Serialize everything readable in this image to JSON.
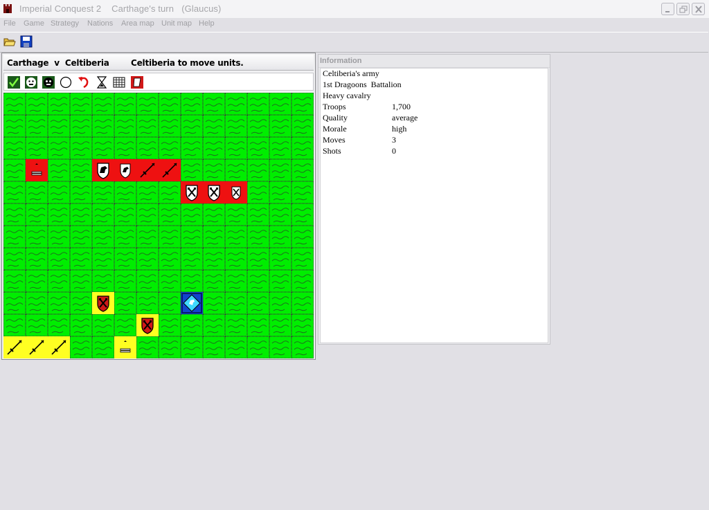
{
  "window": {
    "title": "Imperial Conquest 2    Carthage's turn   (Glaucus)"
  },
  "menu": [
    "File",
    "Game",
    "Strategy",
    "Nations",
    "Area map",
    "Unit map",
    "Help"
  ],
  "toolbar": {
    "buttons": [
      "open-folder-icon",
      "save-disk-icon"
    ]
  },
  "battle": {
    "title": "Carthage  v  Celtiberia",
    "status": "Celtiberia to move units.",
    "tools": [
      "accept-check-icon",
      "face-icon",
      "face-dark-icon",
      "circle-icon",
      "undo-arrow-icon",
      "hourglass-icon",
      "wall-grid-icon",
      "flag-icon"
    ],
    "grid": {
      "cols": 14,
      "rows": 12
    },
    "units": [
      {
        "side": "Carthage",
        "type": "artillery",
        "row": 3,
        "col": 1
      },
      {
        "side": "Carthage",
        "type": "cavalry",
        "row": 3,
        "col": 4
      },
      {
        "side": "Carthage",
        "type": "light-cavalry",
        "row": 3,
        "col": 5
      },
      {
        "side": "Carthage",
        "type": "spearmen",
        "row": 3,
        "col": 6
      },
      {
        "side": "Carthage",
        "type": "spearmen",
        "row": 3,
        "col": 7
      },
      {
        "side": "Carthage",
        "type": "infantry",
        "row": 4,
        "col": 8
      },
      {
        "side": "Carthage",
        "type": "infantry",
        "row": 4,
        "col": 9
      },
      {
        "side": "Carthage",
        "type": "light-infantry",
        "row": 4,
        "col": 10
      },
      {
        "side": "Celtiberia",
        "type": "infantry",
        "row": 9,
        "col": 4
      },
      {
        "side": "Celtiberia",
        "type": "heavy-cavalry-selected",
        "row": 9,
        "col": 8
      },
      {
        "side": "Celtiberia",
        "type": "infantry",
        "row": 10,
        "col": 6
      },
      {
        "side": "Celtiberia",
        "type": "spearmen",
        "row": 11,
        "col": 0
      },
      {
        "side": "Celtiberia",
        "type": "spearmen",
        "row": 11,
        "col": 1
      },
      {
        "side": "Celtiberia",
        "type": "spearmen",
        "row": 11,
        "col": 2
      },
      {
        "side": "Celtiberia",
        "type": "artillery",
        "row": 11,
        "col": 5
      }
    ],
    "colors": {
      "grass": "#00ee00",
      "carthage": "#ee1111",
      "celtiberia": "#ffff22",
      "selected": "#1144cc"
    }
  },
  "info": {
    "title": "Information",
    "army": "Celtiberia's army",
    "unit_name": "1st Dragoons  Battalion",
    "unit_type": "Heavy cavalry",
    "stats": [
      {
        "label": "Troops",
        "value": "1,700"
      },
      {
        "label": "Quality",
        "value": "average"
      },
      {
        "label": "Morale",
        "value": "high"
      },
      {
        "label": "Moves",
        "value": "3"
      },
      {
        "label": "Shots",
        "value": "0"
      }
    ]
  }
}
